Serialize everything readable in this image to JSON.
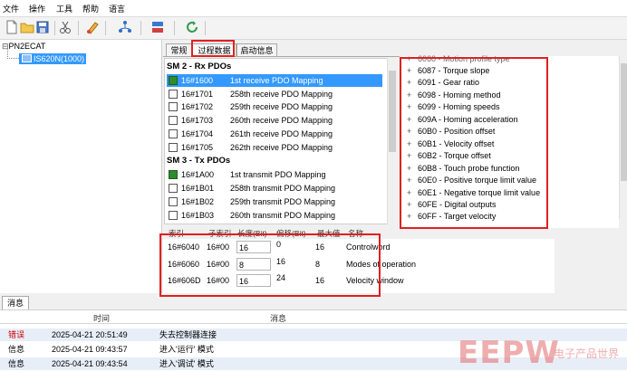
{
  "menu": {
    "items": [
      "文件",
      "操作",
      "工具",
      "帮助",
      "语言"
    ]
  },
  "tree": {
    "root": "PN2ECAT",
    "child": "IS620N(1000)"
  },
  "tabs": [
    "常规",
    "过程数据",
    "启动信息"
  ],
  "pdo": {
    "rx_section": "SM 2 - Rx PDOs",
    "rx": [
      {
        "index": "16#1600",
        "name": "1st receive PDO Mapping",
        "checked": true,
        "selected": true
      },
      {
        "index": "16#1701",
        "name": "258th receive PDO Mapping",
        "checked": false
      },
      {
        "index": "16#1702",
        "name": "259th receive PDO Mapping",
        "checked": false
      },
      {
        "index": "16#1703",
        "name": "260th receive PDO Mapping",
        "checked": false
      },
      {
        "index": "16#1704",
        "name": "261th receive PDO Mapping",
        "checked": false
      },
      {
        "index": "16#1705",
        "name": "262th receive PDO Mapping",
        "checked": false
      }
    ],
    "tx_section": "SM 3 - Tx PDOs",
    "tx": [
      {
        "index": "16#1A00",
        "name": "1st transmit PDO Mapping",
        "checked": true
      },
      {
        "index": "16#1B01",
        "name": "258th transmit PDO Mapping",
        "checked": false
      },
      {
        "index": "16#1B02",
        "name": "259th transmit PDO Mapping",
        "checked": false
      },
      {
        "index": "16#1B03",
        "name": "260th transmit PDO Mapping",
        "checked": false
      }
    ]
  },
  "objects": {
    "partial_top": "6060 - Motion profile type",
    "items": [
      "6087 - Torque slope",
      "6091 - Gear ratio",
      "6098 - Homing method",
      "6099 - Homing speeds",
      "609A - Homing acceleration",
      "60B0 - Position offset",
      "60B1 - Velocity offset",
      "60B2 - Torque offset",
      "60B8 - Touch probe function",
      "60E0 - Positive torque limit value",
      "60E1 - Negative torque limit value",
      "60FE - Digital outputs",
      "60FF - Target velocity"
    ]
  },
  "mapping": {
    "headers": [
      "索引",
      "子索引",
      "长度(Bit)",
      "偏移(Bit)",
      "最大值",
      "名称"
    ],
    "rows": [
      {
        "index": "16#6040",
        "sub": "16#00",
        "length": "16",
        "offset": "0",
        "max": "16",
        "name": "Controlword"
      },
      {
        "index": "16#6060",
        "sub": "16#00",
        "length": "8",
        "offset": "16",
        "max": "8",
        "name": "Modes of operation"
      },
      {
        "index": "16#606D",
        "sub": "16#00",
        "length": "16",
        "offset": "24",
        "max": "16",
        "name": "Velocity window"
      }
    ]
  },
  "messages": {
    "tab_label": "消息",
    "headers": {
      "time": "时间",
      "message": "消息"
    },
    "rows": [
      {
        "type": "错误",
        "time": "2025-04-21 20:51:49",
        "text": "失去控制器连接"
      },
      {
        "type": "信息",
        "time": "2025-04-21 09:43:57",
        "text": "进入'运行' 模式"
      },
      {
        "type": "信息",
        "time": "2025-04-21 09:43:54",
        "text": "进入'调试' 模式"
      }
    ]
  },
  "watermark": {
    "logo": "EEPW",
    "tagline": "电子产品世界"
  }
}
